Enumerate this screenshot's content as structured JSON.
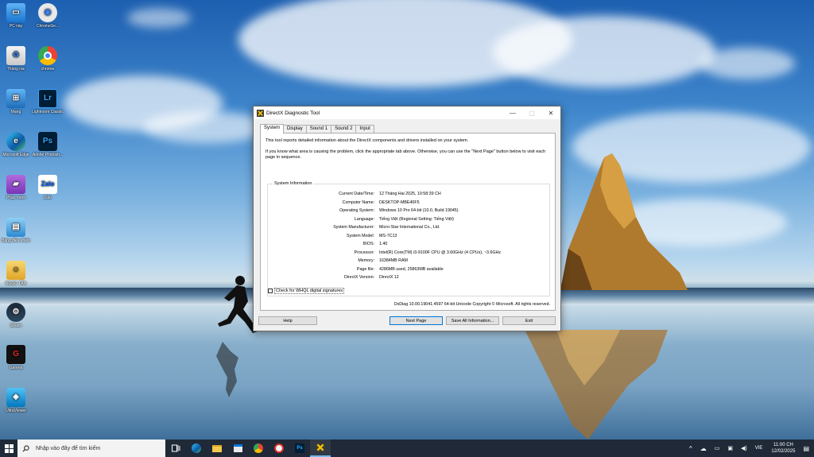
{
  "desktop": {
    "icons": [
      {
        "label": "PC này",
        "icon": "computer-icon"
      },
      {
        "label": "ChromeSe...",
        "icon": "chrome-setup-icon"
      },
      {
        "label": "Thùng rác",
        "icon": "recycle-bin-icon"
      },
      {
        "label": "chrome",
        "icon": "chrome-icon"
      },
      {
        "label": "Mạng",
        "icon": "network-icon"
      },
      {
        "label": "Lightroom Classic",
        "icon": "lightroom-icon"
      },
      {
        "label": "Microsoft Edge",
        "icon": "edge-icon"
      },
      {
        "label": "Adobe Photosh...",
        "icon": "photoshop-icon"
      },
      {
        "label": "Phần mềm",
        "icon": "folder-icon"
      },
      {
        "label": "Zalo",
        "icon": "zalo-icon"
      },
      {
        "label": "Bảng điều khiển",
        "icon": "control-panel-icon"
      },
      {
        "label": "NGỌC TÂN",
        "icon": "user-folder-icon"
      },
      {
        "label": "Steam",
        "icon": "steam-icon"
      },
      {
        "label": "Garena",
        "icon": "garena-icon"
      },
      {
        "label": "UltraViewer",
        "icon": "ultraviewer-icon"
      }
    ]
  },
  "dialog": {
    "title": "DirectX Diagnostic Tool",
    "tabs": [
      "System",
      "Display",
      "Sound 1",
      "Sound 2",
      "Input"
    ],
    "intro_1": "This tool reports detailed information about the DirectX components and drivers installed on your system.",
    "intro_2": "If you know what area is causing the problem, click the appropriate tab above.  Otherwise, you can use the \"Next Page\" button below to visit each page in sequence.",
    "group_title": "System Information",
    "info": [
      {
        "label": "Current Date/Time:",
        "value": "12 Tháng Hai 2025, 10:58:39 CH"
      },
      {
        "label": "Computer Name:",
        "value": "DESKTOP-MBE40F5"
      },
      {
        "label": "Operating System:",
        "value": "Windows 10 Pro 64-bit (10.0, Build 19045)"
      },
      {
        "label": "Language:",
        "value": "Tiếng Việt (Regional Setting: Tiếng Việt)"
      },
      {
        "label": "System Manufacturer:",
        "value": "Micro-Star International Co., Ltd."
      },
      {
        "label": "System Model:",
        "value": "MS-7C13"
      },
      {
        "label": "BIOS:",
        "value": "1.40"
      },
      {
        "label": "Processor:",
        "value": "Intel(R) Core(TM) i3-9100F CPU @ 3.60GHz (4 CPUs), ~3.6GHz"
      },
      {
        "label": "Memory:",
        "value": "16384MB RAM"
      },
      {
        "label": "Page file:",
        "value": "4286MB used, 25863MB available"
      },
      {
        "label": "DirectX Version:",
        "value": "DirectX 12"
      }
    ],
    "whql_label": "Check for WHQL digital signatures",
    "footer": "DxDiag 10.00.19041.4597 64-bit Unicode  Copyright © Microsoft. All rights reserved.",
    "buttons": {
      "help": "Help",
      "next": "Next Page",
      "save": "Save All Information...",
      "exit": "Exit"
    }
  },
  "taskbar": {
    "search_placeholder": "Nhập vào đây để tìm kiếm",
    "lang": "VIE",
    "time": "11:00 CH",
    "date": "12/02/2025"
  }
}
